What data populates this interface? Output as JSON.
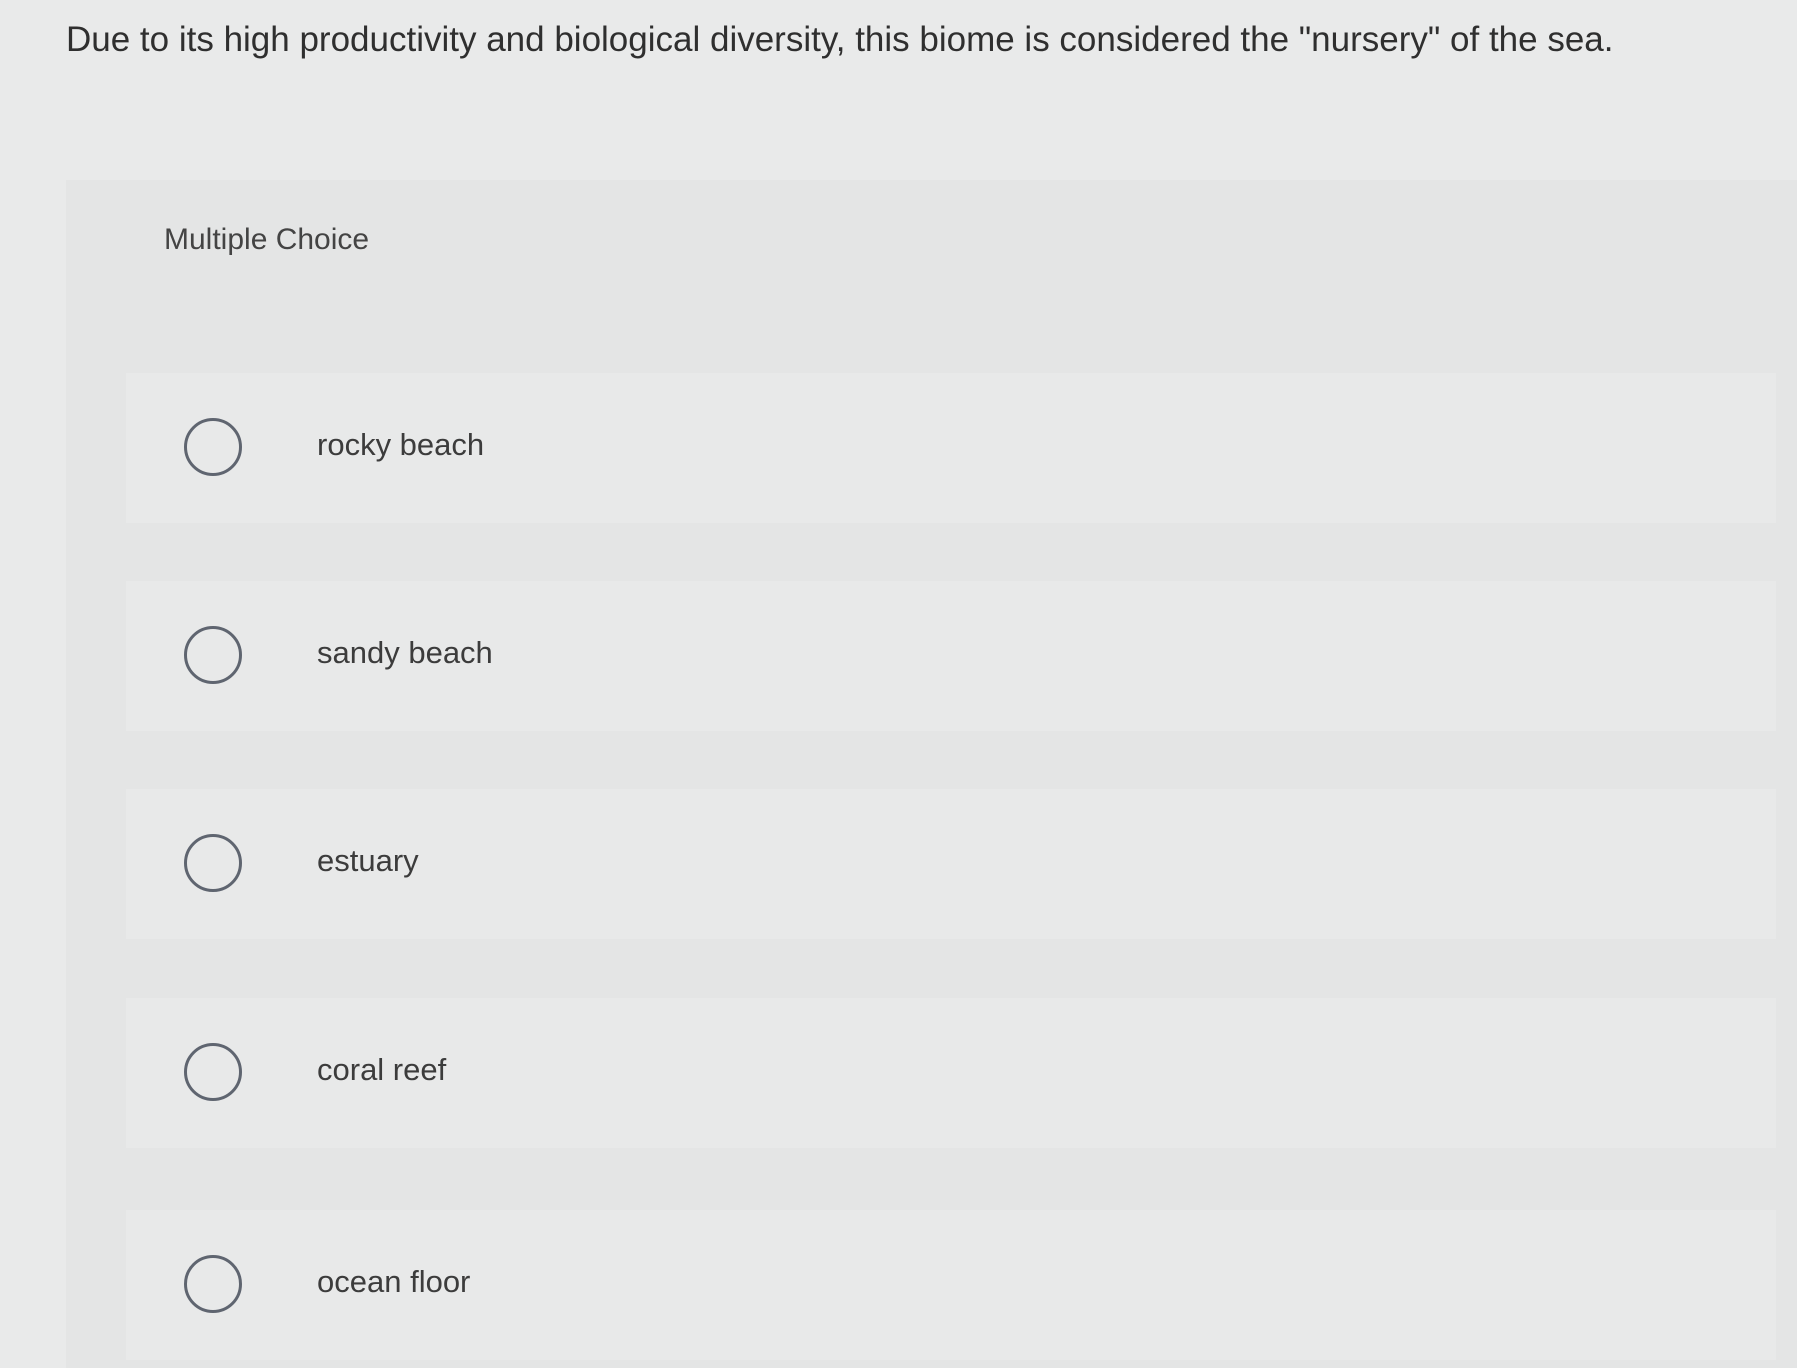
{
  "question": {
    "text": "Due to its high productivity and biological diversity, this biome is considered the \"nursery\" of the sea."
  },
  "question_type": "Multiple Choice",
  "options": [
    {
      "label": "rocky beach",
      "selected": false
    },
    {
      "label": "sandy beach",
      "selected": false
    },
    {
      "label": "estuary",
      "selected": false
    },
    {
      "label": "coral reef",
      "selected": false
    },
    {
      "label": "ocean floor",
      "selected": false
    }
  ],
  "colors": {
    "background": "#e9eaea",
    "text": "#2f2f2f",
    "radio_border": "#5f6570"
  }
}
